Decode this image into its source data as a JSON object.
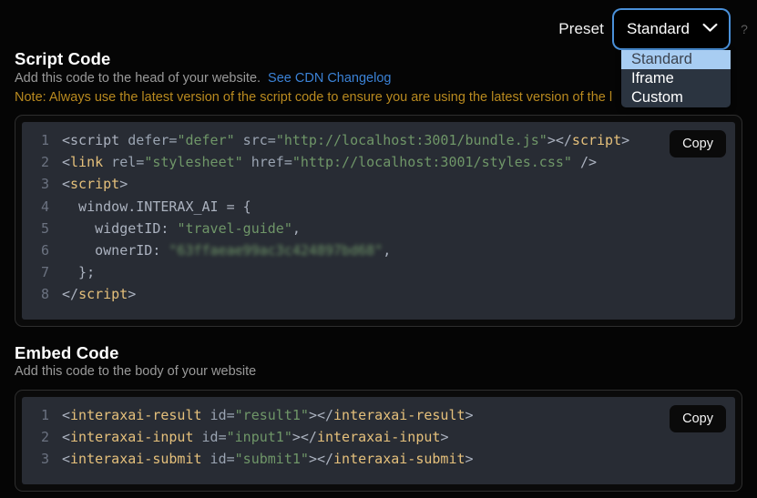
{
  "preset": {
    "label": "Preset",
    "selected": "Standard",
    "chevron_icon": "chevron-down-icon",
    "help_icon": "?",
    "options": [
      {
        "label": "Standard",
        "selected": true
      },
      {
        "label": "Iframe",
        "selected": false
      },
      {
        "label": "Custom",
        "selected": false
      }
    ],
    "focus_color": "#4a90d9",
    "highlight_color": "#a8cdf2"
  },
  "script_section": {
    "title": "Script Code",
    "subtitle": "Add this code to the head of your website.",
    "link_text": "See CDN Changelog",
    "note": "Note: Always use the latest version of the script code to ensure you are using the latest version of the l",
    "note_color": "#b98a1f",
    "copy_label": "Copy",
    "lines": [
      {
        "n": "1",
        "tokens": [
          {
            "t": "<",
            "c": "punct"
          },
          {
            "t": "script",
            "c": "plain"
          },
          {
            "t": " defer=",
            "c": "attr"
          },
          {
            "t": "\"defer\"",
            "c": "str"
          },
          {
            "t": " src=",
            "c": "attr"
          },
          {
            "t": "\"http://localhost:3001/bundle.js\"",
            "c": "str"
          },
          {
            "t": "></",
            "c": "punct"
          },
          {
            "t": "script",
            "c": "tag"
          },
          {
            "t": ">",
            "c": "punct"
          }
        ]
      },
      {
        "n": "2",
        "tokens": [
          {
            "t": "<",
            "c": "punct"
          },
          {
            "t": "link",
            "c": "tag"
          },
          {
            "t": " rel=",
            "c": "attr"
          },
          {
            "t": "\"stylesheet\"",
            "c": "str"
          },
          {
            "t": " href=",
            "c": "attr"
          },
          {
            "t": "\"http://localhost:3001/styles.css\"",
            "c": "str"
          },
          {
            "t": " />",
            "c": "punct"
          }
        ]
      },
      {
        "n": "3",
        "tokens": [
          {
            "t": "<",
            "c": "punct"
          },
          {
            "t": "script",
            "c": "tag"
          },
          {
            "t": ">",
            "c": "punct"
          }
        ]
      },
      {
        "n": "4",
        "tokens": [
          {
            "t": "  window.INTERAX_AI = {",
            "c": "plain"
          }
        ]
      },
      {
        "n": "5",
        "tokens": [
          {
            "t": "    widgetID: ",
            "c": "plain"
          },
          {
            "t": "\"travel-guide\"",
            "c": "str"
          },
          {
            "t": ",",
            "c": "plain"
          }
        ]
      },
      {
        "n": "6",
        "tokens": [
          {
            "t": "    ownerID: ",
            "c": "plain"
          },
          {
            "t": "\"63ffaeae99ac3c424897bd68\"",
            "c": "blur"
          },
          {
            "t": ",",
            "c": "plain"
          }
        ]
      },
      {
        "n": "7",
        "tokens": [
          {
            "t": "  };",
            "c": "plain"
          }
        ]
      },
      {
        "n": "8",
        "tokens": [
          {
            "t": "</",
            "c": "punct"
          },
          {
            "t": "script",
            "c": "tag"
          },
          {
            "t": ">",
            "c": "punct"
          }
        ]
      }
    ]
  },
  "embed_section": {
    "title": "Embed Code",
    "subtitle": "Add this code to the body of your website",
    "copy_label": "Copy",
    "lines": [
      {
        "n": "1",
        "tokens": [
          {
            "t": "<",
            "c": "punct"
          },
          {
            "t": "interaxai-result",
            "c": "tag"
          },
          {
            "t": " id=",
            "c": "attr"
          },
          {
            "t": "\"result1\"",
            "c": "str"
          },
          {
            "t": "></",
            "c": "punct"
          },
          {
            "t": "interaxai-result",
            "c": "tag"
          },
          {
            "t": ">",
            "c": "punct"
          }
        ]
      },
      {
        "n": "2",
        "tokens": [
          {
            "t": "<",
            "c": "punct"
          },
          {
            "t": "interaxai-input",
            "c": "tag"
          },
          {
            "t": " id=",
            "c": "attr"
          },
          {
            "t": "\"input1\"",
            "c": "str"
          },
          {
            "t": "></",
            "c": "punct"
          },
          {
            "t": "interaxai-input",
            "c": "tag"
          },
          {
            "t": ">",
            "c": "punct"
          }
        ]
      },
      {
        "n": "3",
        "tokens": [
          {
            "t": "<",
            "c": "punct"
          },
          {
            "t": "interaxai-submit",
            "c": "tag"
          },
          {
            "t": " id=",
            "c": "attr"
          },
          {
            "t": "\"submit1\"",
            "c": "str"
          },
          {
            "t": "></",
            "c": "punct"
          },
          {
            "t": "interaxai-submit",
            "c": "tag"
          },
          {
            "t": ">",
            "c": "punct"
          }
        ]
      }
    ]
  }
}
